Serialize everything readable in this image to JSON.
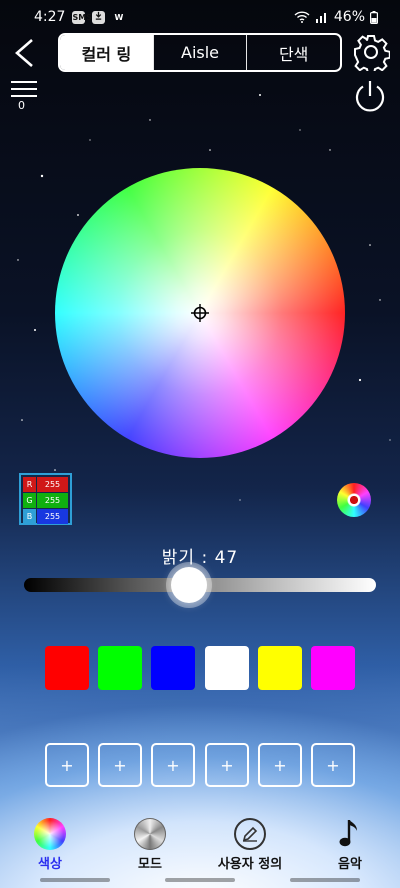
{
  "status_bar": {
    "time": "4:27",
    "notif_icons": [
      "sms-icon",
      "download-icon",
      "w-app-icon"
    ],
    "notif_labels": [
      "SMS",
      "",
      "W"
    ],
    "battery": "46%"
  },
  "nav": {
    "tabs": [
      {
        "label": "컬러 링",
        "active": true
      },
      {
        "label": "Aisle",
        "active": false
      },
      {
        "label": "단색",
        "active": false
      }
    ],
    "menu_count": "0"
  },
  "color": {
    "r_label": "R",
    "g_label": "G",
    "b_label": "B",
    "r": "255",
    "g": "255",
    "b": "255"
  },
  "brightness": {
    "label": "밝기 : 47",
    "value_fraction": 0.47
  },
  "swatches": [
    "#ff0000",
    "#00ff00",
    "#0000ff",
    "#ffffff",
    "#ffff00",
    "#ff00ff"
  ],
  "custom_slots": [
    "+",
    "+",
    "+",
    "+",
    "+",
    "+"
  ],
  "bottom_tabs": [
    {
      "label": "색상",
      "icon": "color-wheel-icon",
      "active": true
    },
    {
      "label": "모드",
      "icon": "mode-disc-icon",
      "active": false
    },
    {
      "label": "사용자 정의",
      "icon": "edit-icon",
      "active": false
    },
    {
      "label": "음악",
      "icon": "music-note-icon",
      "active": false
    }
  ],
  "colors": {
    "active_tab": "#2b2ff0",
    "rgb_border": "#2f9fd6",
    "r_key": "#d01818",
    "g_key": "#10b010",
    "b_key": "#1838e0"
  }
}
